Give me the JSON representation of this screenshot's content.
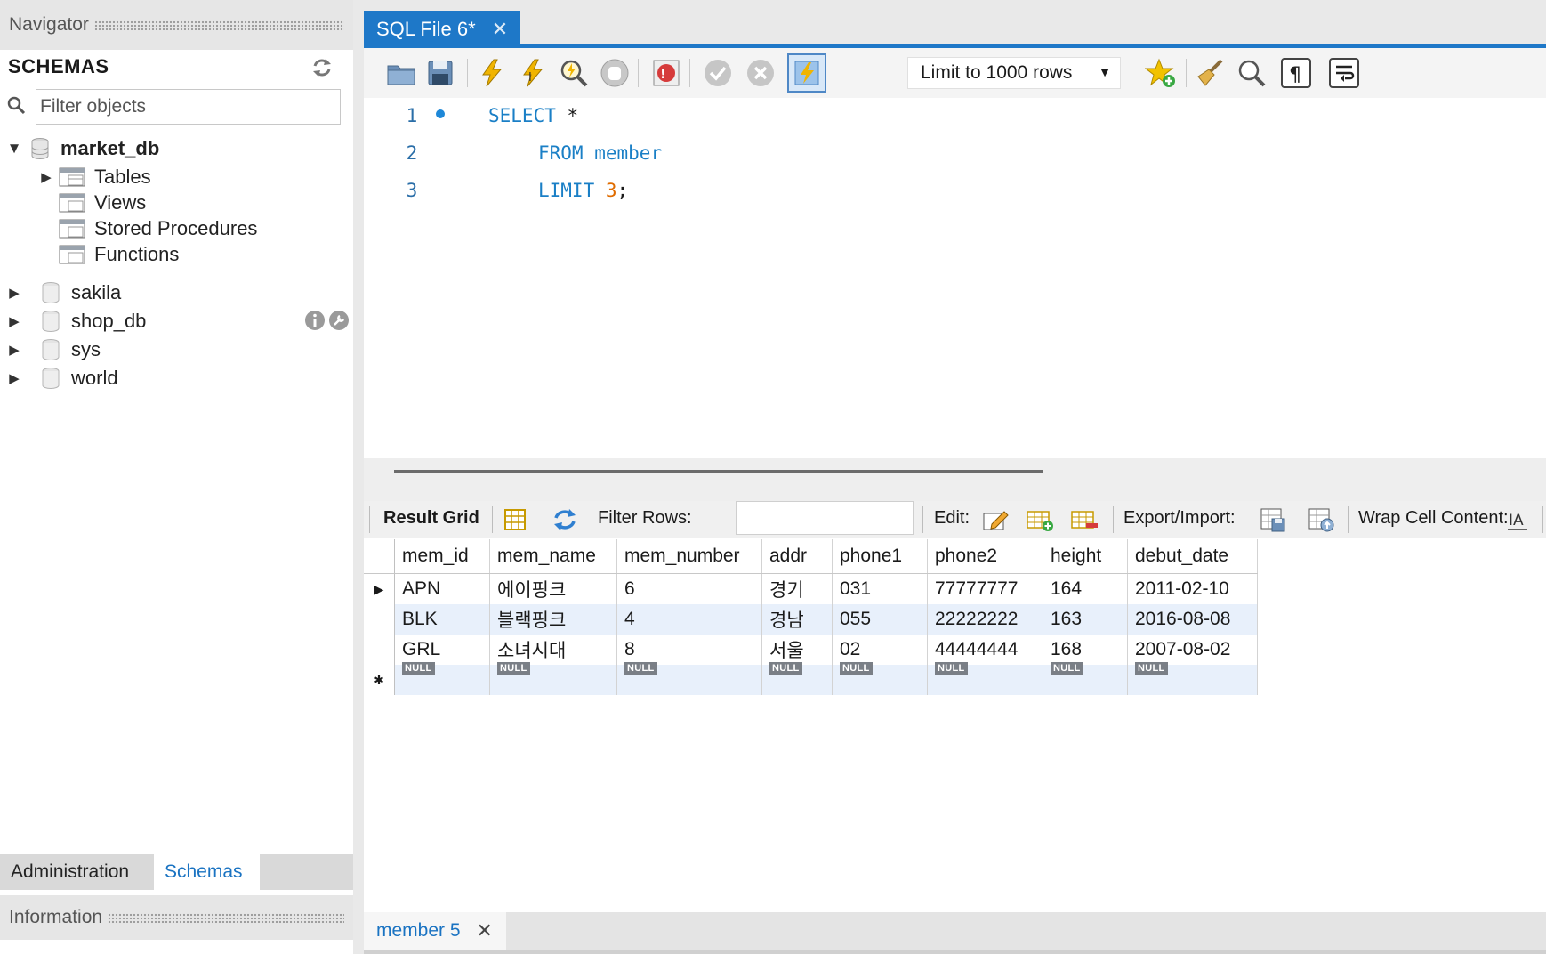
{
  "navigator": {
    "title": "Navigator",
    "schemas_label": "SCHEMAS",
    "filter_placeholder": "Filter objects",
    "tree": {
      "market_db": "market_db",
      "children": [
        "Tables",
        "Views",
        "Stored Procedures",
        "Functions"
      ],
      "others": [
        "sakila",
        "shop_db",
        "sys",
        "world"
      ]
    },
    "tabs": {
      "admin": "Administration",
      "schemas": "Schemas"
    },
    "info_title": "Information"
  },
  "editor": {
    "tab_label": "SQL File 6*",
    "limit_label": "Limit to 1000 rows",
    "lines": [
      "1",
      "2",
      "3"
    ],
    "code": {
      "select": "SELECT",
      "star": "*",
      "from": "FROM",
      "table": "member",
      "limit": "LIMIT",
      "limit_value": "3",
      "semicolon": ";"
    }
  },
  "result_toolbar": {
    "result_grid": "Result Grid",
    "filter_rows": "Filter Rows:",
    "edit": "Edit:",
    "export_import": "Export/Import:",
    "wrap_cell": "Wrap Cell Content:"
  },
  "grid": {
    "columns": [
      "mem_id",
      "mem_name",
      "mem_number",
      "addr",
      "phone1",
      "phone2",
      "height",
      "debut_date"
    ],
    "rows": [
      [
        "APN",
        "에이핑크",
        "6",
        "경기",
        "031",
        "77777777",
        "164",
        "2011-02-10"
      ],
      [
        "BLK",
        "블랙핑크",
        "4",
        "경남",
        "055",
        "22222222",
        "163",
        "2016-08-08"
      ],
      [
        "GRL",
        "소녀시대",
        "8",
        "서울",
        "02",
        "44444444",
        "168",
        "2007-08-02"
      ]
    ],
    "null_label": "NULL"
  },
  "result_tab": {
    "label": "member 5"
  },
  "colors": {
    "accent": "#1e78c8",
    "keyword": "#1a7fc6",
    "number": "#e06c00",
    "row_alt": "#e8f0fb"
  }
}
